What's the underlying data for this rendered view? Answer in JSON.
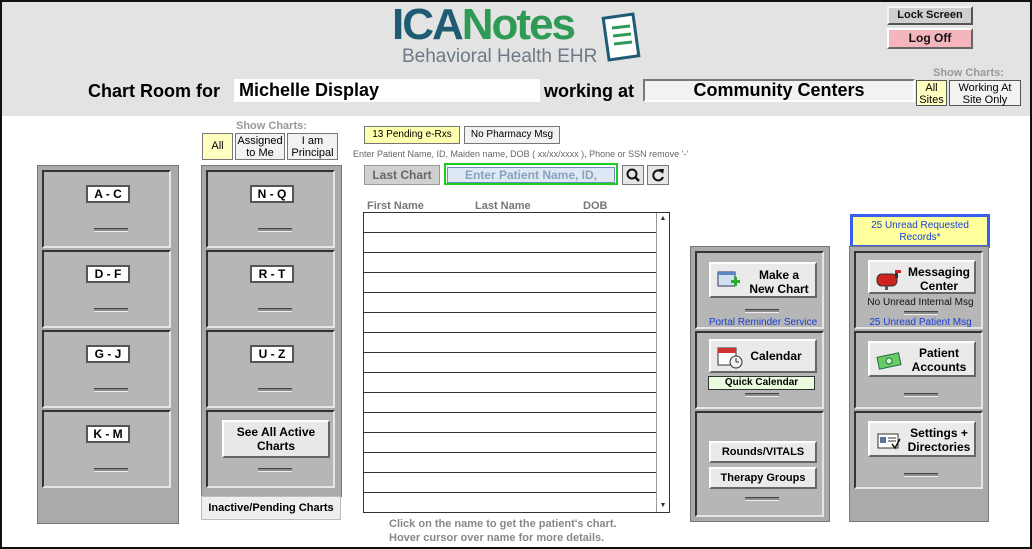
{
  "header": {
    "logo_title_a": "ICA",
    "logo_title_b": "Notes",
    "logo_subtitle": "Behavioral Health EHR",
    "lock_screen": "Lock Screen",
    "log_off": "Log Off",
    "chart_room_label": "Chart Room for",
    "patient_name": "Michelle Display",
    "working_at_label": "working at",
    "site_name": "Community Centers",
    "show_charts_label": "Show Charts:",
    "all_sites": "All Sites",
    "working_at_site_only": "Working At Site Only"
  },
  "filters": {
    "label": "Show Charts:",
    "all": "All",
    "assigned": "Assigned to Me",
    "principal": "I am Principal"
  },
  "cabinets": {
    "left": [
      "A - C",
      "D - F",
      "G - J",
      "K - M"
    ],
    "right": [
      "N - Q",
      "R - T",
      "U - Z"
    ],
    "see_all": "See All Active Charts",
    "inactive": "Inactive/Pending Charts"
  },
  "search": {
    "pending_erx": "13 Pending e-Rxs",
    "no_pharmacy": "No Pharmacy Msg",
    "instructions": "Enter Patient Name, ID, Maiden name, DOB ( xx/xx/xxxx ), Phone or SSN remove '-'",
    "last_chart": "Last Chart",
    "placeholder": "Enter Patient Name, ID,",
    "col_first": "First Name",
    "col_last": "Last Name",
    "col_dob": "DOB",
    "help_line1": "Click on the name to get the patient's chart.",
    "help_line2": "Hover cursor over name for more details."
  },
  "actions": {
    "make_chart": "Make a New Chart",
    "portal_reminder": "Portal Reminder Service",
    "calendar": "Calendar",
    "quick_calendar": "Quick Calendar",
    "rounds": "Rounds/VITALS",
    "therapy": "Therapy Groups",
    "unread_requested": "25 Unread Requested Records*",
    "messaging": "Messaging Center",
    "no_unread_internal": "No Unread Internal Msg",
    "unread_patient": "25 Unread Patient Msg",
    "patient_accounts": "Patient Accounts",
    "settings": "Settings + Directories"
  },
  "colors": {
    "accent_yellow": "#ffffc0",
    "logoff_pink": "#f5b5bd",
    "link_blue": "#1a3fd8",
    "search_green": "#1dcc1d"
  }
}
